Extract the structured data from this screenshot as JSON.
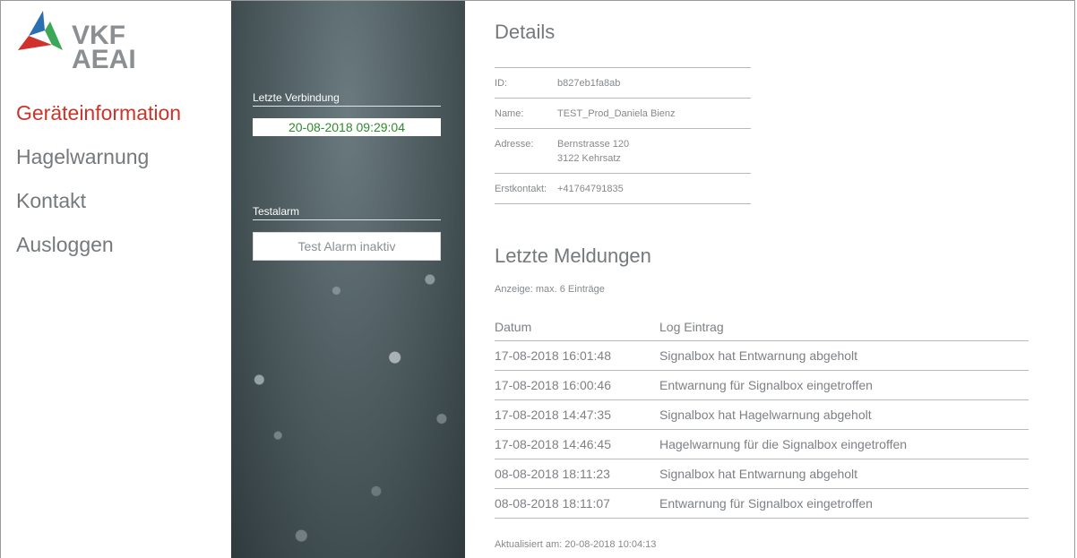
{
  "logo": {
    "line1": "VKF",
    "line2": "AEAI"
  },
  "nav": {
    "items": [
      {
        "label": "Geräteinformation",
        "active": true
      },
      {
        "label": "Hagelwarnung",
        "active": false
      },
      {
        "label": "Kontakt",
        "active": false
      },
      {
        "label": "Ausloggen",
        "active": false
      }
    ]
  },
  "panel": {
    "connection_label": "Letzte Verbindung",
    "connection_value": "20-08-2018 09:29:04",
    "testalarm_label": "Testalarm",
    "testalarm_button": "Test Alarm inaktiv"
  },
  "details": {
    "title": "Details",
    "rows": [
      {
        "key": "ID:",
        "value": "b827eb1fa8ab",
        "value2": ""
      },
      {
        "key": "Name:",
        "value": "TEST_Prod_Daniela Bienz",
        "value2": ""
      },
      {
        "key": "Adresse:",
        "value": "Bernstrasse 120",
        "value2": "3122 Kehrsatz"
      },
      {
        "key": "Erstkontakt:",
        "value": "+41764791835",
        "value2": ""
      }
    ]
  },
  "meldungen": {
    "title": "Letzte Meldungen",
    "anzeige": "Anzeige: max. 6 Einträge",
    "headers": [
      "Datum",
      "Log Eintrag"
    ],
    "rows": [
      {
        "date": "17-08-2018 16:01:48",
        "entry": "Signalbox hat Entwarnung abgeholt"
      },
      {
        "date": "17-08-2018 16:00:46",
        "entry": "Entwarnung für Signalbox eingetroffen"
      },
      {
        "date": "17-08-2018 14:47:35",
        "entry": "Signalbox hat Hagelwarnung abgeholt"
      },
      {
        "date": "17-08-2018 14:46:45",
        "entry": "Hagelwarnung für die Signalbox eingetroffen"
      },
      {
        "date": "08-08-2018 18:11:23",
        "entry": "Signalbox hat Entwarnung abgeholt"
      },
      {
        "date": "08-08-2018 18:11:07",
        "entry": "Entwarnung für Signalbox eingetroffen"
      }
    ],
    "updated": "Aktualisiert am: 20-08-2018 10:04:13"
  },
  "colors": {
    "active_nav": "#c9352b",
    "connection_text": "#2e8b2e",
    "logo_red": "#d0312d",
    "logo_green": "#3aa856",
    "logo_blue": "#2a6fb0"
  }
}
